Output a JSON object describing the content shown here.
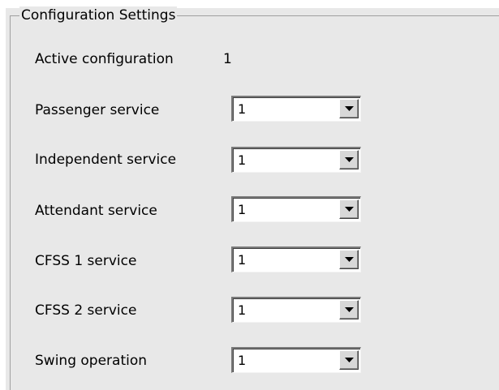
{
  "group": {
    "title": "Configuration Settings"
  },
  "active": {
    "label": "Active configuration",
    "value": "1"
  },
  "rows": [
    {
      "label": "Passenger service",
      "value": "1"
    },
    {
      "label": "Independent service",
      "value": "1"
    },
    {
      "label": "Attendant service",
      "value": "1"
    },
    {
      "label": "CFSS 1 service",
      "value": "1"
    },
    {
      "label": "CFSS 2 service",
      "value": "1"
    },
    {
      "label": "Swing operation",
      "value": "1"
    }
  ],
  "icons": {
    "dropdown": "chevron-down-icon"
  },
  "colors": {
    "panel_background": "#e8e8e8",
    "frame_border": "#a0a0a0"
  }
}
